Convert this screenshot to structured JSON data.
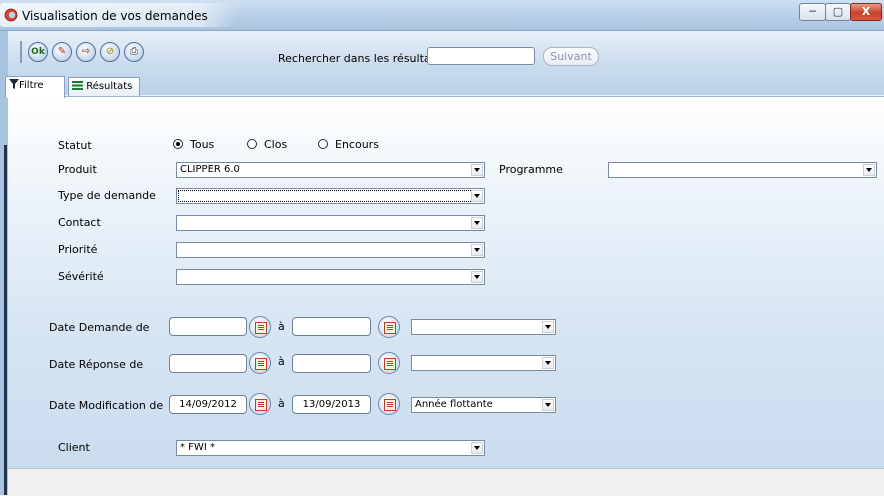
{
  "window": {
    "title": "Visualisation de vos demandes",
    "min_glyph": "─",
    "max_glyph": "▢",
    "close_glyph": "X"
  },
  "toolbar": {
    "buttons": [
      {
        "name": "ok-button",
        "glyph": "Ok"
      },
      {
        "name": "erase-button",
        "glyph": "✎"
      },
      {
        "name": "exit-button",
        "glyph": "⇨"
      },
      {
        "name": "link-button",
        "glyph": "⊘"
      },
      {
        "name": "print-button",
        "glyph": "⎙"
      }
    ],
    "search_label": "Rechercher dans les résultats",
    "search_value": "",
    "next_label": "Suivant"
  },
  "tabs": [
    {
      "label": "Filtre",
      "active": true
    },
    {
      "label": "Résultats",
      "active": false
    }
  ],
  "filter": {
    "statut_label": "Statut",
    "statut_options": [
      "Tous",
      "Clos",
      "Encours"
    ],
    "statut_selected": "Tous",
    "produit_label": "Produit",
    "produit_value": "CLIPPER 6.0",
    "programme_label": "Programme",
    "programme_value": "",
    "type_label": "Type de demande",
    "type_value": "",
    "contact_label": "Contact",
    "contact_value": "",
    "priorite_label": "Priorité",
    "priorite_value": "",
    "severite_label": "Sévérité",
    "severite_value": "",
    "a_label": "à",
    "date_demande_label": "Date Demande de",
    "date_demande_from": "",
    "date_demande_to": "",
    "date_demande_period": "",
    "date_reponse_label": "Date Réponse de",
    "date_reponse_from": "",
    "date_reponse_to": "",
    "date_reponse_period": "",
    "date_modif_label": "Date Modification de",
    "date_modif_from": "14/09/2012",
    "date_modif_to": "13/09/2013",
    "date_modif_period": "Année flottante",
    "client_label": "Client",
    "client_value": "* FWI *"
  }
}
